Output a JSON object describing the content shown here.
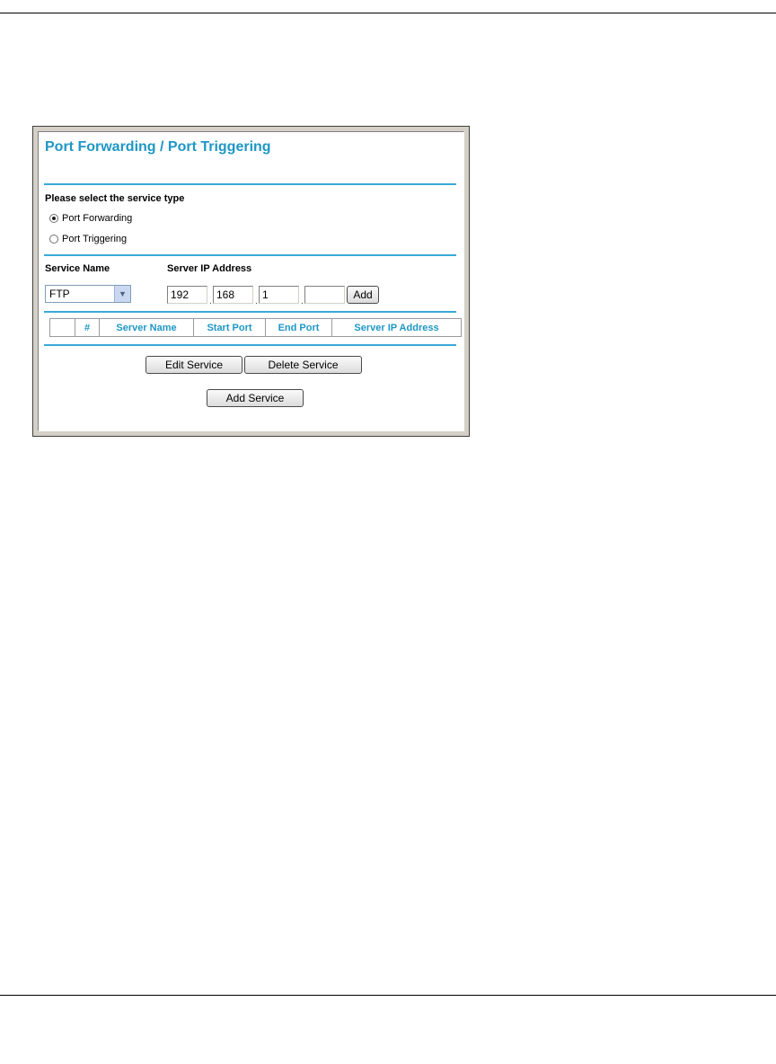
{
  "panel": {
    "title": "Port Forwarding / Port Triggering",
    "service_type_label": "Please select the service type",
    "radio_options": [
      {
        "label": "Port Forwarding",
        "checked": true
      },
      {
        "label": "Port Triggering",
        "checked": false
      }
    ],
    "service_name_label": "Service Name",
    "service_name_value": "FTP",
    "server_ip_label": "Server IP Address",
    "ip_octets": [
      "192",
      "168",
      "1",
      ""
    ],
    "add_label": "Add",
    "table_headers": [
      "",
      "#",
      "Server Name",
      "Start Port",
      "End Port",
      "Server IP Address"
    ],
    "edit_service_label": "Edit Service",
    "delete_service_label": "Delete Service",
    "add_service_label": "Add Service"
  },
  "colors": {
    "accent": "#1e97c5",
    "rule": "#3aa8d8",
    "frame": "#d4d0c8"
  },
  "icons": {
    "dropdown": "chevron-down-icon"
  }
}
